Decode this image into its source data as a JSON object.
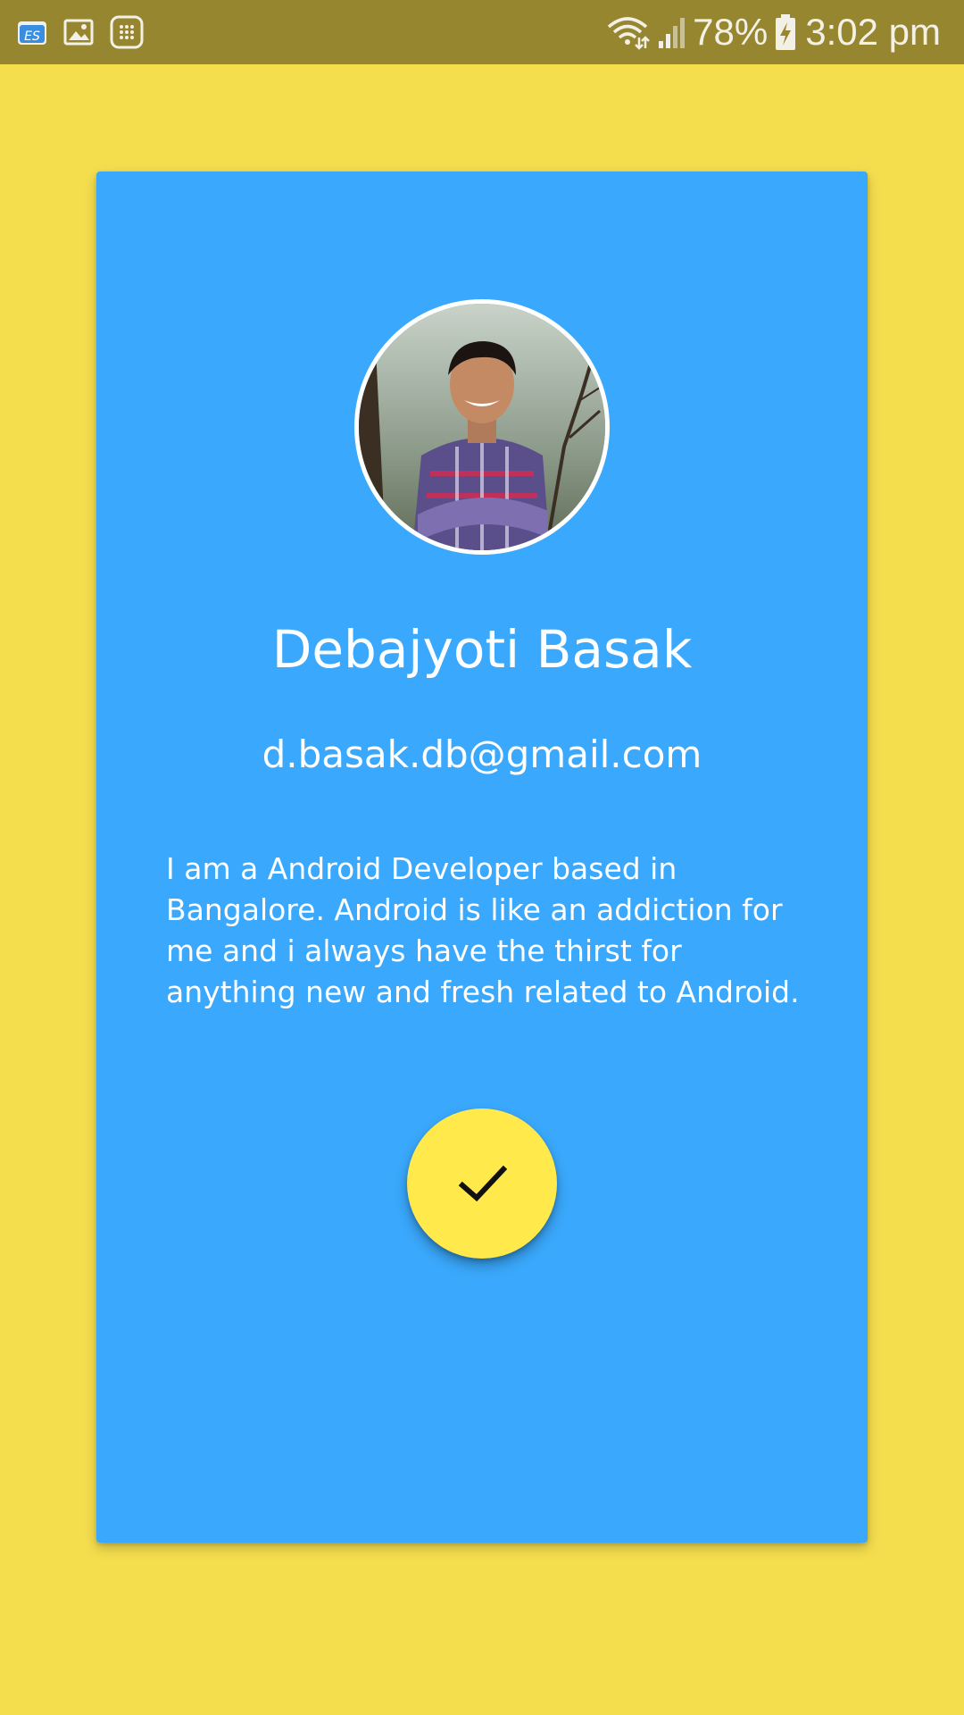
{
  "status_bar": {
    "left_icons": [
      "es-file-explorer-icon",
      "gallery-icon",
      "app-grid-icon"
    ],
    "right_icons": [
      "wifi-icon",
      "signal-icon",
      "battery-charging-icon"
    ],
    "battery": "78%",
    "time": "3:02 pm"
  },
  "profile": {
    "avatar": "profile-photo",
    "name": "Debajyoti Basak",
    "email": "d.basak.db@gmail.com",
    "bio": "I am a Android Developer based in Bangalore. Android is like an addiction for me and i always have the thirst for anything new and fresh related to Android."
  },
  "fab": {
    "icon": "check-icon"
  },
  "colors": {
    "background": "#F5DE4E",
    "status_bar": "#978630",
    "card": "#3AA8FC",
    "fab": "#FFE94B",
    "text": "#FFFFFF"
  }
}
